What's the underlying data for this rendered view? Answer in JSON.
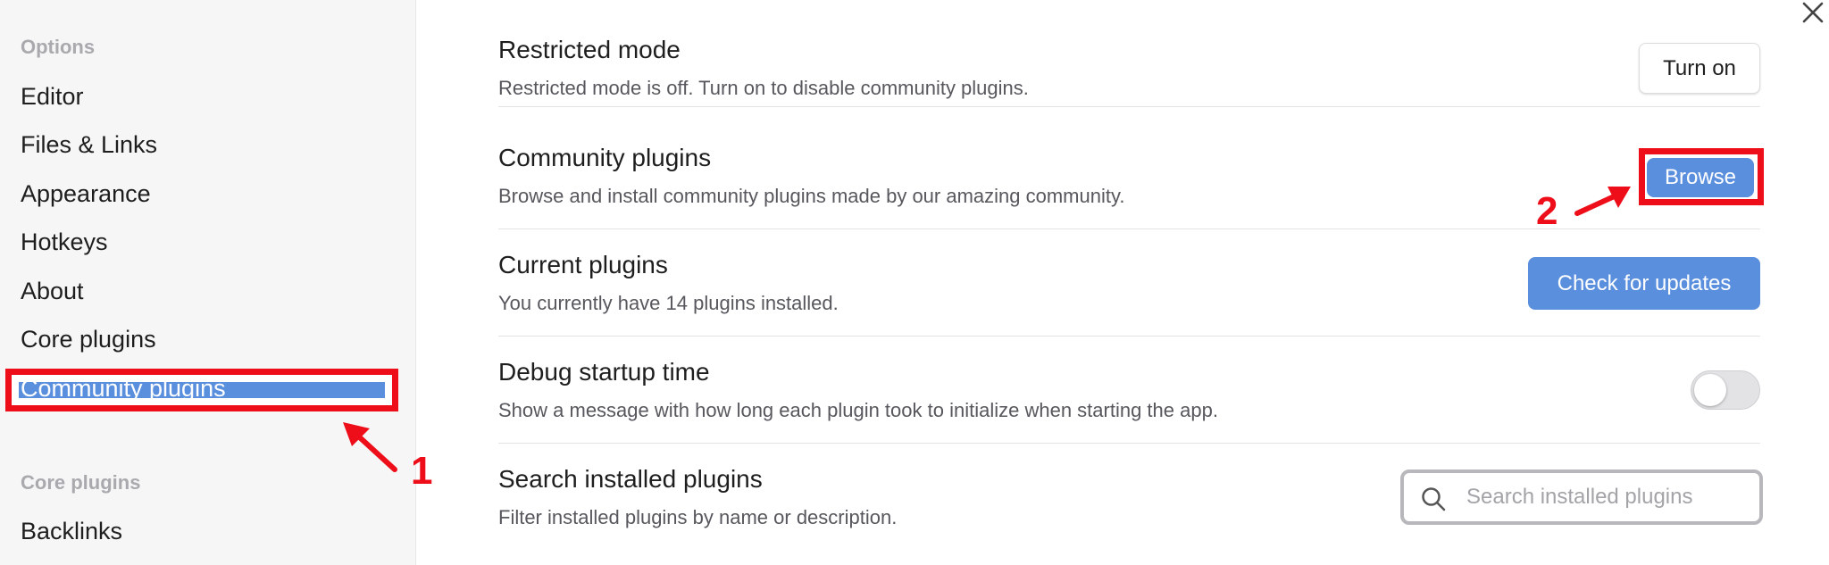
{
  "sidebar": {
    "options_heading": "Options",
    "items": [
      {
        "label": "Editor"
      },
      {
        "label": "Files & Links"
      },
      {
        "label": "Appearance"
      },
      {
        "label": "Hotkeys"
      },
      {
        "label": "About"
      },
      {
        "label": "Core plugins"
      },
      {
        "label": "Community plugins",
        "active": true
      }
    ],
    "core_plugins_heading": "Core plugins",
    "core_items": [
      {
        "label": "Backlinks"
      }
    ]
  },
  "settings": {
    "restricted_mode": {
      "title": "Restricted mode",
      "description": "Restricted mode is off. Turn on to disable community plugins.",
      "button_label": "Turn on"
    },
    "community_plugins": {
      "title": "Community plugins",
      "description": "Browse and install community plugins made by our amazing community.",
      "button_label": "Browse"
    },
    "current_plugins": {
      "title": "Current plugins",
      "description": "You currently have 14 plugins installed.",
      "button_label": "Check for updates"
    },
    "debug_startup": {
      "title": "Debug startup time",
      "description": "Show a message with how long each plugin took to initialize when starting the app.",
      "toggle_on": false
    },
    "search_plugins": {
      "title": "Search installed plugins",
      "description": "Filter installed plugins by name or description.",
      "placeholder": "Search installed plugins"
    }
  },
  "annotations": {
    "step1": "1",
    "step2": "2",
    "color": "#ee0e1a"
  },
  "colors": {
    "accent": "#5a8fde",
    "sidebar_bg": "#f6f6f7"
  }
}
